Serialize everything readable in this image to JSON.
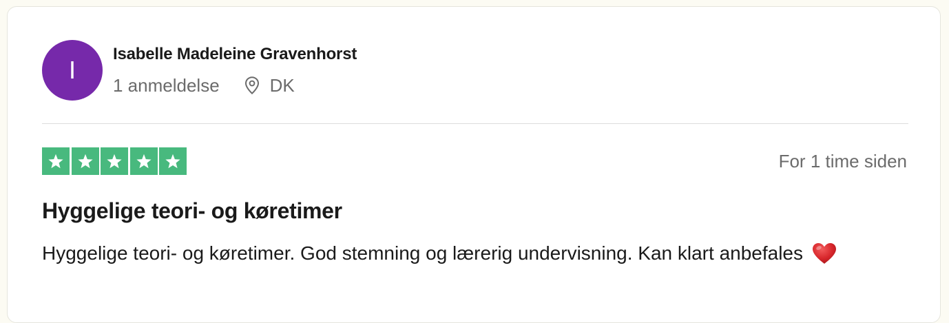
{
  "review": {
    "avatar_initial": "I",
    "avatar_color": "#7629aa",
    "reviewer_name": "Isabelle Madeleine Gravenhorst",
    "review_count": "1 anmeldelse",
    "location_icon": "location-pin-icon",
    "country": "DK",
    "rating": 5,
    "rating_max": 5,
    "star_color": "#48b97e",
    "date": "For 1 time siden",
    "title": "Hyggelige teori- og køretimer",
    "body": "Hyggelige teori- og køretimer. God stemning og lærerig undervisning. Kan klart anbefales",
    "body_emoji": "red-heart-icon"
  }
}
